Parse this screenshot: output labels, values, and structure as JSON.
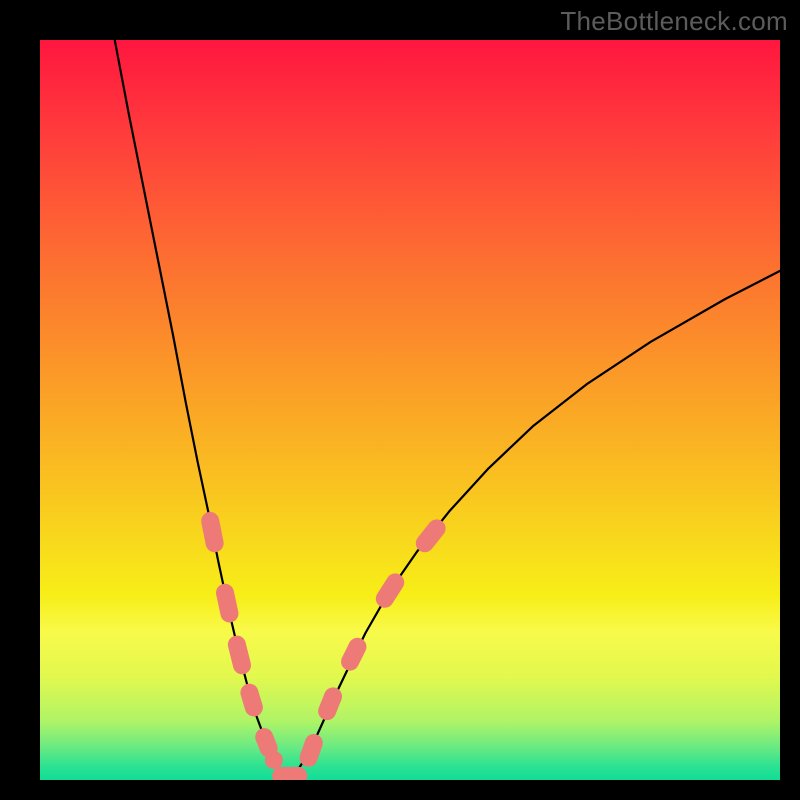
{
  "watermark": "TheBottleneck.com",
  "chart_data": {
    "type": "line",
    "title": "",
    "xlabel": "",
    "ylabel": "",
    "xlim": [
      0,
      100
    ],
    "ylim": [
      0,
      100
    ],
    "grid": false,
    "legend": false,
    "notes": "Two black curves descending into a V on a vertical red→yellow→green gradient. No axis ticks or labels. Salmon-colored data markers (rounded segments) line the lower portion of both curves near the vertex. Bottom narrow band is green.",
    "gradient_stops": [
      {
        "offset": 0.0,
        "color": "#ff163f"
      },
      {
        "offset": 0.12,
        "color": "#ff3a3c"
      },
      {
        "offset": 0.28,
        "color": "#fd6a32"
      },
      {
        "offset": 0.45,
        "color": "#fb9928"
      },
      {
        "offset": 0.62,
        "color": "#f9c81f"
      },
      {
        "offset": 0.75,
        "color": "#f7ee18"
      },
      {
        "offset": 0.8,
        "color": "#f8fa4a"
      },
      {
        "offset": 0.86,
        "color": "#e2f84e"
      },
      {
        "offset": 0.92,
        "color": "#b0f466"
      },
      {
        "offset": 0.955,
        "color": "#6bea82"
      },
      {
        "offset": 0.98,
        "color": "#2fe291"
      },
      {
        "offset": 1.0,
        "color": "#10dd97"
      }
    ],
    "series": [
      {
        "name": "left-branch",
        "x": [
          10.1,
          12.0,
          14.0,
          16.0,
          18.0,
          19.7,
          21.3,
          22.9,
          24.1,
          25.5,
          26.8,
          28.1,
          29.3,
          30.6,
          31.6,
          32.7,
          33.5
        ],
        "y": [
          100.0,
          90.0,
          80.0,
          70.0,
          60.0,
          51.0,
          43.0,
          35.5,
          29.5,
          23.0,
          17.5,
          12.5,
          8.5,
          5.0,
          2.5,
          0.8,
          0.0
        ]
      },
      {
        "name": "right-branch",
        "x": [
          33.5,
          34.6,
          35.9,
          37.5,
          39.3,
          41.5,
          44.0,
          47.1,
          50.9,
          55.3,
          60.5,
          66.6,
          73.9,
          82.5,
          92.6,
          100.0
        ],
        "y": [
          0.0,
          1.0,
          3.0,
          6.2,
          10.2,
          14.8,
          19.9,
          25.3,
          30.8,
          36.3,
          42.0,
          47.8,
          53.5,
          59.2,
          65.0,
          68.8
        ]
      }
    ],
    "markers": {
      "color": "#ed7a76",
      "radius_px": 9,
      "points_left": [
        {
          "x": 23.0,
          "y": 35.0
        },
        {
          "x": 23.6,
          "y": 32.0
        },
        {
          "x": 25.0,
          "y": 25.3
        },
        {
          "x": 25.6,
          "y": 22.5
        },
        {
          "x": 26.6,
          "y": 18.3
        },
        {
          "x": 27.3,
          "y": 15.5
        },
        {
          "x": 28.3,
          "y": 11.8
        },
        {
          "x": 28.9,
          "y": 9.8
        },
        {
          "x": 30.3,
          "y": 5.8
        },
        {
          "x": 30.9,
          "y": 4.3
        },
        {
          "x": 31.6,
          "y": 2.7
        }
      ],
      "points_bottom": [
        {
          "x": 32.6,
          "y": 0.55
        },
        {
          "x": 33.7,
          "y": 0.15
        },
        {
          "x": 34.9,
          "y": 0.55
        }
      ],
      "points_right": [
        {
          "x": 36.3,
          "y": 3.0
        },
        {
          "x": 37.0,
          "y": 5.0
        },
        {
          "x": 38.8,
          "y": 9.3
        },
        {
          "x": 39.6,
          "y": 11.3
        },
        {
          "x": 41.9,
          "y": 16.0
        },
        {
          "x": 42.9,
          "y": 18.0
        },
        {
          "x": 46.6,
          "y": 24.5
        },
        {
          "x": 48.0,
          "y": 26.7
        },
        {
          "x": 52.0,
          "y": 32.0
        },
        {
          "x": 53.6,
          "y": 34.0
        }
      ]
    }
  }
}
